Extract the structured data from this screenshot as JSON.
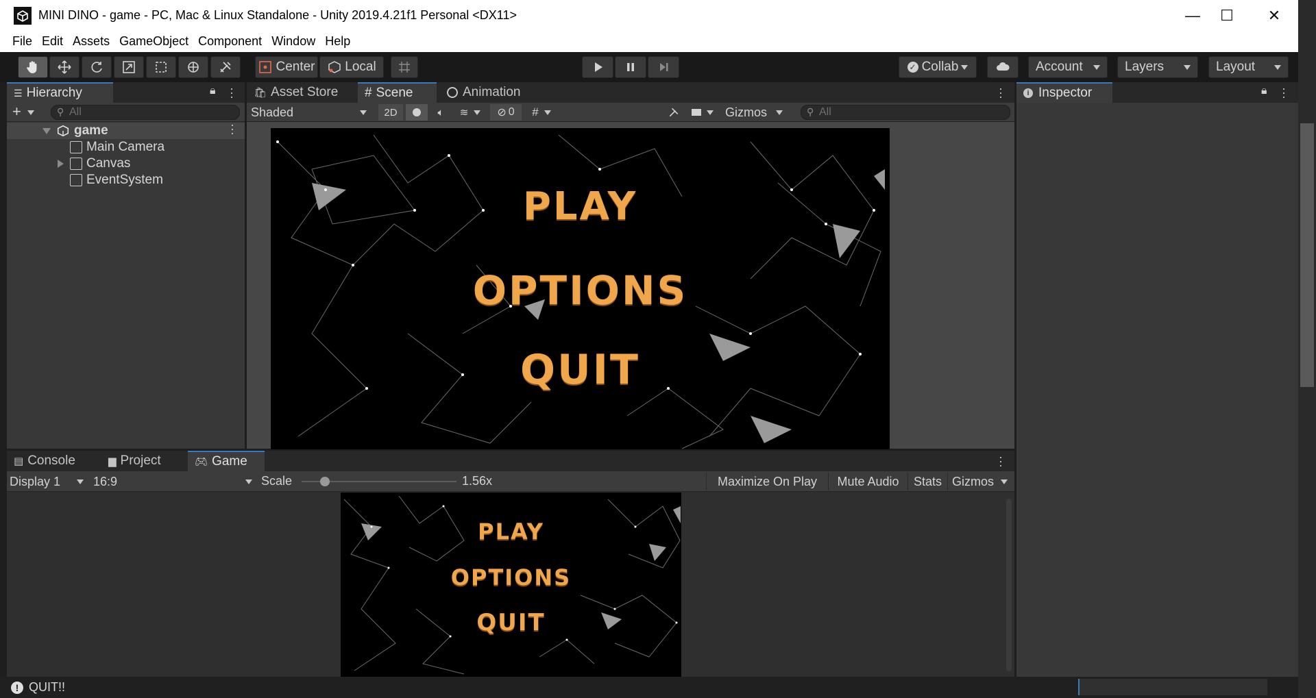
{
  "window": {
    "title": "MINI DINO - game - PC, Mac & Linux Standalone - Unity 2019.4.21f1 Personal <DX11>",
    "minimize": "—",
    "maximize": "☐",
    "close": "✕"
  },
  "menu": [
    "File",
    "Edit",
    "Assets",
    "GameObject",
    "Component",
    "Window",
    "Help"
  ],
  "toolbar": {
    "pivot": "Center",
    "space": "Local",
    "collab": "Collab",
    "account": "Account",
    "layers": "Layers",
    "layout": "Layout"
  },
  "hierarchy": {
    "tab": "Hierarchy",
    "search_placeholder": "All",
    "scene": "game",
    "items": [
      "Main Camera",
      "Canvas",
      "EventSystem"
    ]
  },
  "scene_tabs": [
    "Asset Store",
    "Scene",
    "Animation"
  ],
  "scene_toolbar": {
    "shading": "Shaded",
    "mode2d": "2D",
    "hidden_count": "0",
    "gizmos": "Gizmos",
    "search_placeholder": "All"
  },
  "game_menu": {
    "play": "PLAY",
    "options": "OPTIONS",
    "quit": "QUIT"
  },
  "inspector": {
    "tab": "Inspector"
  },
  "bottom_tabs": [
    "Console",
    "Project",
    "Game"
  ],
  "game_toolbar": {
    "display": "Display 1",
    "aspect": "16:9",
    "scale_label": "Scale",
    "scale_value": "1.56x",
    "scale_fraction": 0.15,
    "maximize_on_play": "Maximize On Play",
    "mute_audio": "Mute Audio",
    "stats": "Stats",
    "gizmos": "Gizmos"
  },
  "status": {
    "message": "QUIT!!"
  },
  "colors": {
    "accent": "#3a79bb",
    "menu_text": "#f0a64a"
  }
}
